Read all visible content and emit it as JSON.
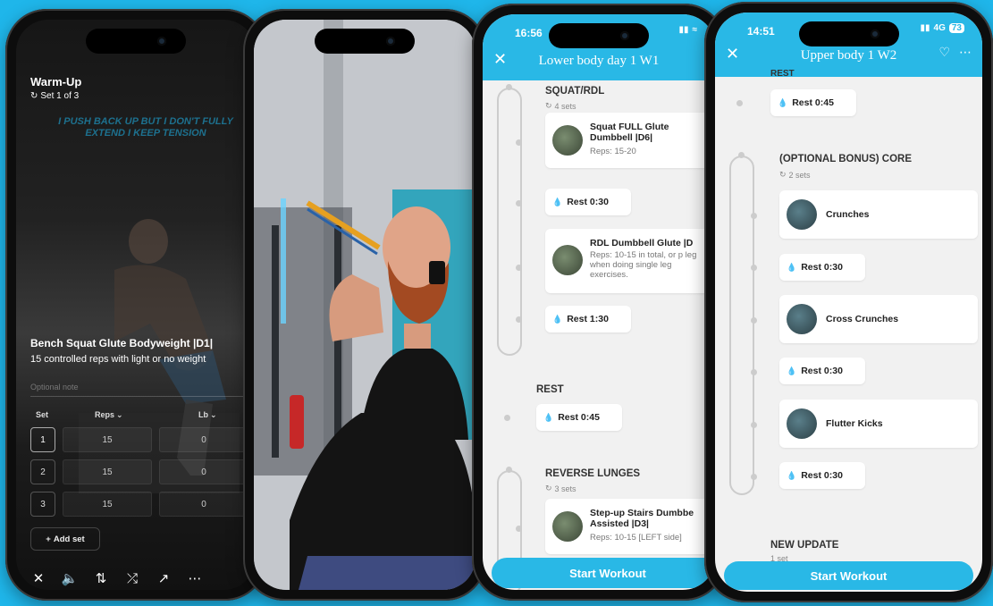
{
  "phone1": {
    "title": "Warm-Up",
    "set_indicator": "Set 1 of 3",
    "overlay_text": "I PUSH BACK UP BUT I DON'T FULLY EXTEND I KEEP TENSION",
    "exercise_name": "Bench Squat Glute Bodyweight |D1|",
    "exercise_desc": "15 controlled reps with light or no weight",
    "note_placeholder": "Optional note",
    "columns": {
      "set": "Set",
      "reps": "Reps",
      "weight": "Lb"
    },
    "rows": [
      {
        "set": "1",
        "reps": "15",
        "weight": "0"
      },
      {
        "set": "2",
        "reps": "15",
        "weight": "0"
      },
      {
        "set": "3",
        "reps": "15",
        "weight": "0"
      }
    ],
    "add_set": "Add set"
  },
  "phone3": {
    "time": "16:56",
    "title": "Lower body day 1 W1",
    "sections": [
      {
        "title": "SQUAT/RDL",
        "sets": "4 sets"
      },
      {
        "title": "REST"
      },
      {
        "title": "REVERSE LUNGES",
        "sets": "3 sets"
      }
    ],
    "cards": [
      {
        "name": "Squat FULL Glute Dumbbell |D6|",
        "desc": "Reps: 15-20"
      },
      {
        "name": "RDL Dumbbell Glute |D",
        "desc": "Reps: 10-15 in total, or p leg when doing single leg exercises."
      },
      {
        "name": "Step-up Stairs Dumbbe Assisted |D3|",
        "desc": "Reps: 10-15 [LEFT side]"
      }
    ],
    "rests": [
      "Rest 0:30",
      "Rest 1:30",
      "Rest 0:45"
    ],
    "start_button": "Start Workout"
  },
  "phone4": {
    "time": "14:51",
    "network": "4G",
    "battery": "73",
    "title": "Upper body 1 W2",
    "top_partial": "REST",
    "rest_top": "Rest 0:45",
    "section_title": "(OPTIONAL BONUS) CORE",
    "section_sets": "2 sets",
    "exercises": [
      "Crunches",
      "Cross Crunches",
      "Flutter Kicks"
    ],
    "rests": [
      "Rest 0:30",
      "Rest 0:30",
      "Rest 0:30"
    ],
    "new_update_title": "NEW UPDATE",
    "new_update_sets": "1 set",
    "start_button": "Start Workout"
  }
}
